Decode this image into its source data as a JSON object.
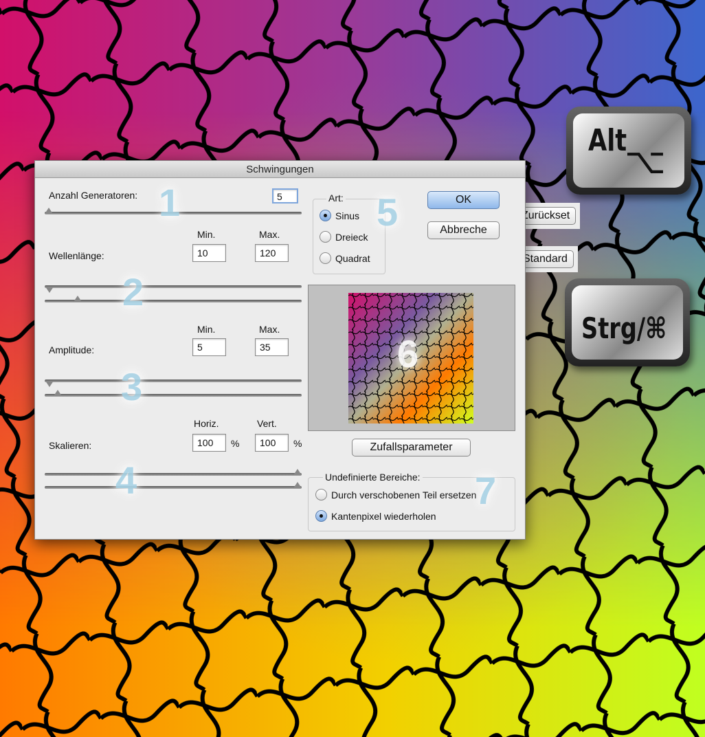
{
  "dialog": {
    "title": "Schwingungen"
  },
  "generators": {
    "label": "Anzahl Generatoren:",
    "value": "5",
    "slider_fraction": 0.0
  },
  "wavelength": {
    "label": "Wellenlänge:",
    "min_label": "Min.",
    "max_label": "Max.",
    "min": "10",
    "max": "120"
  },
  "amplitude": {
    "label": "Amplitude:",
    "min_label": "Min.",
    "max_label": "Max.",
    "min": "5",
    "max": "35"
  },
  "scale": {
    "label": "Skalieren:",
    "horiz_label": "Horiz.",
    "vert_label": "Vert.",
    "horiz": "100",
    "vert": "100",
    "unit": "%"
  },
  "type": {
    "label": "Art:",
    "options": [
      "Sinus",
      "Dreieck",
      "Quadrat"
    ],
    "selected": "Sinus"
  },
  "buttons": {
    "ok": "OK",
    "cancel": "Abbreche",
    "reset": "Zurückset",
    "default": "Standard",
    "randomize": "Zufallsparameter"
  },
  "undefined": {
    "label": "Undefinierte Bereiche:",
    "options": [
      "Durch verschobenen Teil ersetzen",
      "Kantenpixel wiederholen"
    ],
    "selected": "Kantenpixel wiederholen"
  },
  "callouts": [
    "1",
    "2",
    "3",
    "4",
    "5",
    "6",
    "7"
  ],
  "keys": {
    "alt": "Alt",
    "alt_symbol": "⌥",
    "ctrl": "Strg/⌘"
  }
}
